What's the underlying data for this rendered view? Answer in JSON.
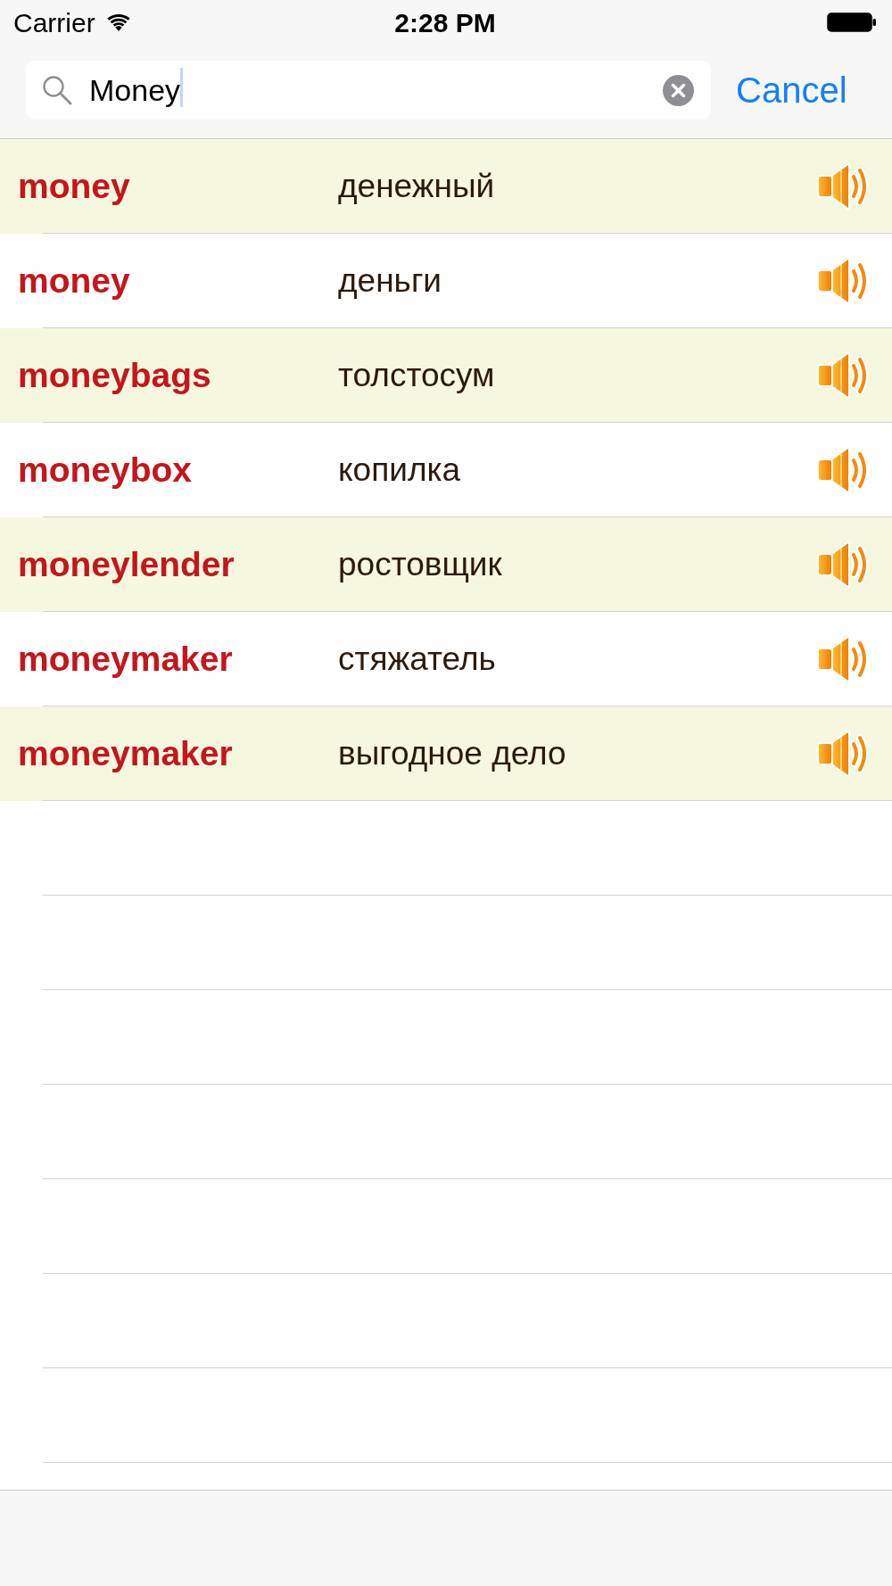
{
  "status_bar": {
    "carrier": "Carrier",
    "time": "2:28 PM"
  },
  "search": {
    "value": "Money",
    "focused": true
  },
  "cancel_button": "Cancel",
  "results": [
    {
      "word": "money",
      "translation": "денежный"
    },
    {
      "word": "money",
      "translation": "деньги"
    },
    {
      "word": "moneybags",
      "translation": "толстосум"
    },
    {
      "word": "moneybox",
      "translation": "копилка"
    },
    {
      "word": "moneylender",
      "translation": "ростовщик"
    },
    {
      "word": "moneymaker",
      "translation": "стяжатель"
    },
    {
      "word": "moneymaker",
      "translation": "выгодное дело"
    }
  ]
}
